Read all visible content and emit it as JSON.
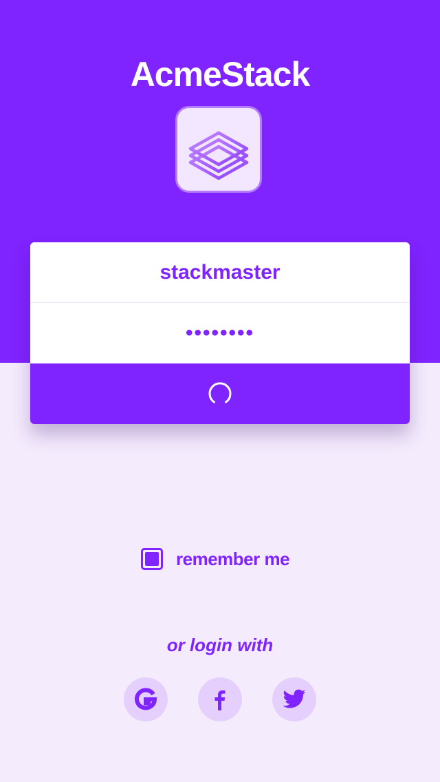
{
  "app": {
    "title": "AcmeStack",
    "logo_icon": "stack-layers-icon"
  },
  "login_form": {
    "username_value": "stackmaster",
    "password_value": "••••••••",
    "submit_state": "loading",
    "submit_icon": "spinner-icon"
  },
  "remember_me": {
    "label": "remember me",
    "checked": true
  },
  "social_login": {
    "heading": "or login with",
    "providers": [
      {
        "name": "google",
        "icon": "google-icon"
      },
      {
        "name": "facebook",
        "icon": "facebook-icon"
      },
      {
        "name": "twitter",
        "icon": "twitter-icon"
      }
    ]
  },
  "colors": {
    "primary": "#7F23FF",
    "background_light": "#F4EBFD",
    "social_bg": "#E5CFFD",
    "card_bg": "#FFFFFF"
  }
}
